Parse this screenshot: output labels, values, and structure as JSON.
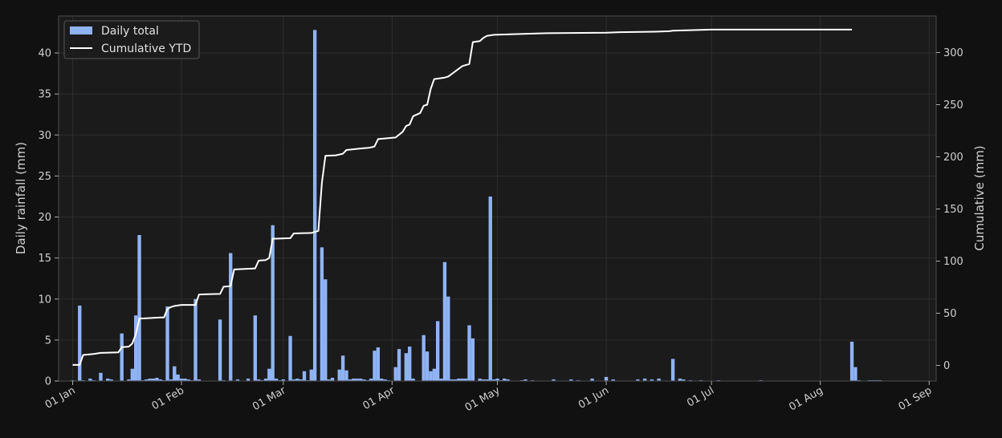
{
  "chart_data": {
    "type": "bar+line",
    "title": "",
    "xlabel": "",
    "ylabel": "Daily rainfall (mm)",
    "y2label": "Cumulative (mm)",
    "ylim": [
      0,
      44.5
    ],
    "y2lim": [
      -15,
      335
    ],
    "yticks": [
      0,
      5,
      10,
      15,
      20,
      25,
      30,
      35,
      40
    ],
    "y2ticks": [
      0,
      50,
      100,
      150,
      200,
      250,
      300
    ],
    "x_range": [
      "2023-12-28",
      "2023-09-01"
    ],
    "x_range_days": [
      -4,
      246
    ],
    "x_ticks": [
      {
        "date": "2024-01-01",
        "label": "01 Jan"
      },
      {
        "date": "2024-02-01",
        "label": "01 Feb"
      },
      {
        "date": "2024-03-01",
        "label": "01 Mar"
      },
      {
        "date": "2024-04-01",
        "label": "01 Apr"
      },
      {
        "date": "2024-05-01",
        "label": "01 May"
      },
      {
        "date": "2024-06-01",
        "label": "01 Jun"
      },
      {
        "date": "2024-07-01",
        "label": "01 Jul"
      },
      {
        "date": "2024-08-01",
        "label": "01 Aug"
      },
      {
        "date": "2024-09-01",
        "label": "01 Sep"
      }
    ],
    "grid": true,
    "legend": {
      "position": "top-left",
      "entries": [
        "Daily total",
        "Cumulative YTD"
      ]
    },
    "colors": {
      "bars": "#8fb3f5",
      "line": "#ffffff",
      "background": "#1b1b1b",
      "page": "#111111",
      "grid": "#333333"
    },
    "series": [
      {
        "name": "Daily total",
        "kind": "bar",
        "dates": [
          "2024-01-01",
          "2024-01-03",
          "2024-01-04",
          "2024-01-06",
          "2024-01-07",
          "2024-01-09",
          "2024-01-11",
          "2024-01-12",
          "2024-01-15",
          "2024-01-17",
          "2024-01-18",
          "2024-01-19",
          "2024-01-20",
          "2024-01-21",
          "2024-01-22",
          "2024-01-23",
          "2024-01-24",
          "2024-01-25",
          "2024-01-26",
          "2024-01-27",
          "2024-01-28",
          "2024-01-29",
          "2024-01-30",
          "2024-01-31",
          "2024-02-01",
          "2024-02-02",
          "2024-02-03",
          "2024-02-04",
          "2024-02-05",
          "2024-02-06",
          "2024-02-12",
          "2024-02-13",
          "2024-02-15",
          "2024-02-17",
          "2024-02-20",
          "2024-02-22",
          "2024-02-23",
          "2024-02-24",
          "2024-02-25",
          "2024-02-26",
          "2024-02-27",
          "2024-02-28",
          "2024-02-29",
          "2024-03-01",
          "2024-03-03",
          "2024-03-04",
          "2024-03-05",
          "2024-03-06",
          "2024-03-07",
          "2024-03-08",
          "2024-03-09",
          "2024-03-10",
          "2024-03-12",
          "2024-03-13",
          "2024-03-14",
          "2024-03-15",
          "2024-03-17",
          "2024-03-18",
          "2024-03-19",
          "2024-03-20",
          "2024-03-21",
          "2024-03-22",
          "2024-03-23",
          "2024-03-24",
          "2024-03-25",
          "2024-03-26",
          "2024-03-27",
          "2024-03-28",
          "2024-03-29",
          "2024-03-30",
          "2024-03-31",
          "2024-04-02",
          "2024-04-03",
          "2024-04-05",
          "2024-04-06",
          "2024-04-07",
          "2024-04-10",
          "2024-04-11",
          "2024-04-12",
          "2024-04-13",
          "2024-04-14",
          "2024-04-15",
          "2024-04-16",
          "2024-04-17",
          "2024-04-18",
          "2024-04-19",
          "2024-04-20",
          "2024-04-21",
          "2024-04-22",
          "2024-04-23",
          "2024-04-24",
          "2024-04-26",
          "2024-04-27",
          "2024-04-28",
          "2024-04-29",
          "2024-04-30",
          "2024-05-01",
          "2024-05-02",
          "2024-05-03",
          "2024-05-04",
          "2024-05-08",
          "2024-05-09",
          "2024-05-11",
          "2024-05-17",
          "2024-05-22",
          "2024-05-24",
          "2024-05-28",
          "2024-06-01",
          "2024-06-03",
          "2024-06-10",
          "2024-06-12",
          "2024-06-14",
          "2024-06-16",
          "2024-06-20",
          "2024-06-22",
          "2024-06-23",
          "2024-06-25",
          "2024-06-28",
          "2024-07-03",
          "2024-07-15",
          "2024-08-10",
          "2024-08-11",
          "2024-08-12",
          "2024-08-15",
          "2024-08-16",
          "2024-08-17",
          "2024-08-18"
        ],
        "values": [
          0.1,
          9.2,
          0.1,
          0.3,
          0.1,
          1.0,
          0.3,
          0.2,
          5.8,
          0.2,
          1.5,
          8.0,
          17.8,
          0.1,
          0.2,
          0.3,
          0.3,
          0.4,
          0.2,
          0.1,
          9.1,
          0.2,
          1.8,
          0.8,
          0.3,
          0.3,
          0.2,
          0.1,
          10.0,
          0.2,
          7.5,
          0.1,
          15.6,
          0.2,
          0.3,
          8.0,
          0.2,
          0.1,
          0.3,
          1.5,
          19.0,
          0.3,
          0.1,
          0.2,
          5.5,
          0.2,
          0.3,
          0.2,
          1.2,
          0.1,
          1.4,
          42.8,
          16.3,
          12.4,
          0.2,
          0.4,
          1.4,
          3.1,
          1.3,
          0.2,
          0.3,
          0.3,
          0.3,
          0.2,
          0.1,
          0.3,
          3.7,
          4.1,
          0.3,
          0.2,
          0.1,
          1.7,
          3.9,
          3.4,
          4.2,
          0.3,
          5.6,
          3.6,
          1.2,
          1.5,
          7.3,
          0.3,
          14.5,
          10.3,
          0.2,
          0.2,
          0.3,
          0.3,
          0.3,
          6.8,
          5.2,
          0.3,
          0.2,
          0.2,
          22.5,
          0.2,
          0.3,
          0.1,
          0.3,
          0.2,
          0.1,
          0.2,
          0.1,
          0.2,
          0.2,
          0.1,
          0.3,
          0.5,
          0.2,
          0.2,
          0.3,
          0.2,
          0.3,
          2.7,
          0.3,
          0.2,
          0.1,
          0.1,
          0.1,
          0.1,
          4.8,
          1.7,
          0.1,
          0.1,
          0.1,
          0.1,
          0.1
        ]
      },
      {
        "name": "Cumulative YTD",
        "kind": "line",
        "axis": "right",
        "dates": [
          "2024-01-01",
          "2024-01-03",
          "2024-01-04",
          "2024-01-07",
          "2024-01-09",
          "2024-01-14",
          "2024-01-15",
          "2024-01-17",
          "2024-01-18",
          "2024-01-19",
          "2024-01-20",
          "2024-01-21",
          "2024-01-26",
          "2024-01-27",
          "2024-01-28",
          "2024-01-29",
          "2024-01-30",
          "2024-02-01",
          "2024-02-05",
          "2024-02-06",
          "2024-02-12",
          "2024-02-13",
          "2024-02-15",
          "2024-02-16",
          "2024-02-22",
          "2024-02-23",
          "2024-02-25",
          "2024-02-26",
          "2024-02-27",
          "2024-02-28",
          "2024-03-03",
          "2024-03-04",
          "2024-03-09",
          "2024-03-10",
          "2024-03-11",
          "2024-03-12",
          "2024-03-13",
          "2024-03-16",
          "2024-03-18",
          "2024-03-19",
          "2024-03-23",
          "2024-03-25",
          "2024-03-26",
          "2024-03-27",
          "2024-03-28",
          "2024-04-02",
          "2024-04-04",
          "2024-04-05",
          "2024-04-06",
          "2024-04-07",
          "2024-04-09",
          "2024-04-10",
          "2024-04-11",
          "2024-04-12",
          "2024-04-13",
          "2024-04-14",
          "2024-04-16",
          "2024-04-17",
          "2024-04-21",
          "2024-04-22",
          "2024-04-23",
          "2024-04-24",
          "2024-04-26",
          "2024-04-27",
          "2024-04-28",
          "2024-04-30",
          "2024-05-15",
          "2024-06-01",
          "2024-06-05",
          "2024-06-15",
          "2024-06-19",
          "2024-06-20",
          "2024-06-25",
          "2024-07-01",
          "2024-08-10",
          "2024-08-11",
          "2024-08-13",
          "2024-08-18"
        ],
        "values": [
          0.5,
          0.5,
          10,
          11,
          12,
          12.5,
          17.5,
          18,
          21,
          30,
          45,
          45,
          46,
          46,
          54,
          56,
          57,
          58,
          58,
          68,
          68.5,
          75.5,
          76,
          92,
          93,
          100.5,
          101,
          103,
          121.5,
          121.5,
          122,
          126.5,
          127,
          128,
          129,
          175,
          201,
          201.5,
          203,
          206.5,
          208,
          208.5,
          209,
          210,
          217,
          218.5,
          224,
          229.5,
          231,
          239,
          242,
          249,
          250,
          265,
          274.5,
          275,
          276,
          277,
          287,
          288,
          289,
          310,
          311,
          314,
          316,
          317,
          318.5,
          319,
          319.5,
          320,
          320.5,
          321,
          321.5,
          322,
          322
        ]
      }
    ]
  }
}
